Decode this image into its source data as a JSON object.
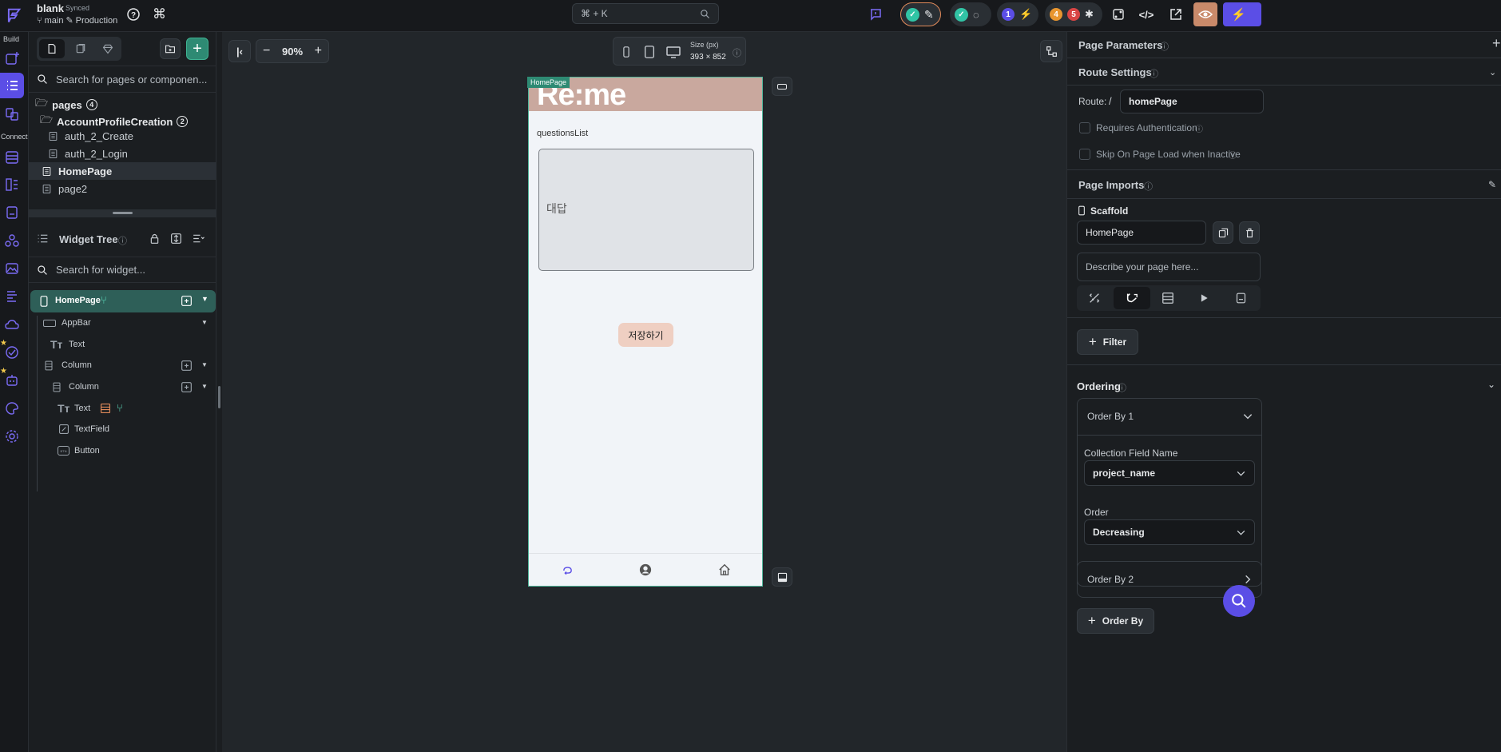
{
  "topbar": {
    "project_name": "blank",
    "sync_status": "Synced",
    "branch": "main",
    "environment": "Production",
    "command_search_placeholder": "⌘ + K",
    "badge_1": "1",
    "badge_4": "4",
    "badge_5": "5"
  },
  "rail": {
    "build_label": "Build",
    "connect_label": "Connect"
  },
  "left": {
    "page_search_placeholder": "Search for pages or componen...",
    "pages_label": "pages",
    "pages_count": "4",
    "folder_name": "AccountProfileCreation",
    "folder_count": "2",
    "pages": [
      "auth_2_Create",
      "auth_2_Login",
      "HomePage",
      "page2"
    ],
    "widget_tree_title": "Widget Tree",
    "widget_search_placeholder": "Search for widget...",
    "tree": {
      "root": "HomePage",
      "appbar": "AppBar",
      "text1": "Text",
      "column1": "Column",
      "column2": "Column",
      "text2": "Text",
      "textfield": "TextField",
      "button": "Button"
    }
  },
  "canvas": {
    "zoom": "90%",
    "size_label": "Size (px)",
    "size_value": "393 × 852",
    "page_tag": "HomePage",
    "phone": {
      "appbar_title": "Re:me",
      "list_label": "questionsList",
      "textfield_hint": "대답",
      "save_button": "저장하기",
      "accent_color": "#c9a89e",
      "bg_color": "#f1f4f8"
    }
  },
  "right": {
    "page_parameters": "Page Parameters",
    "route_settings": "Route Settings",
    "route_label": "Route:",
    "route_slash": "/",
    "route_value": "homePage",
    "requires_auth": "Requires Authentication",
    "skip_on_load": "Skip On Page Load when Inactive",
    "page_imports": "Page Imports",
    "scaffold_label": "Scaffold",
    "page_name_value": "HomePage",
    "describe_placeholder": "Describe your page here...",
    "filter_button": "Filter",
    "ordering_title": "Ordering",
    "order_by_1": "Order By 1",
    "collection_field_label": "Collection Field Name",
    "collection_field_value": "project_name",
    "order_label": "Order",
    "order_value": "Decreasing",
    "order_by_2": "Order By 2",
    "add_order_by": "Order By"
  }
}
